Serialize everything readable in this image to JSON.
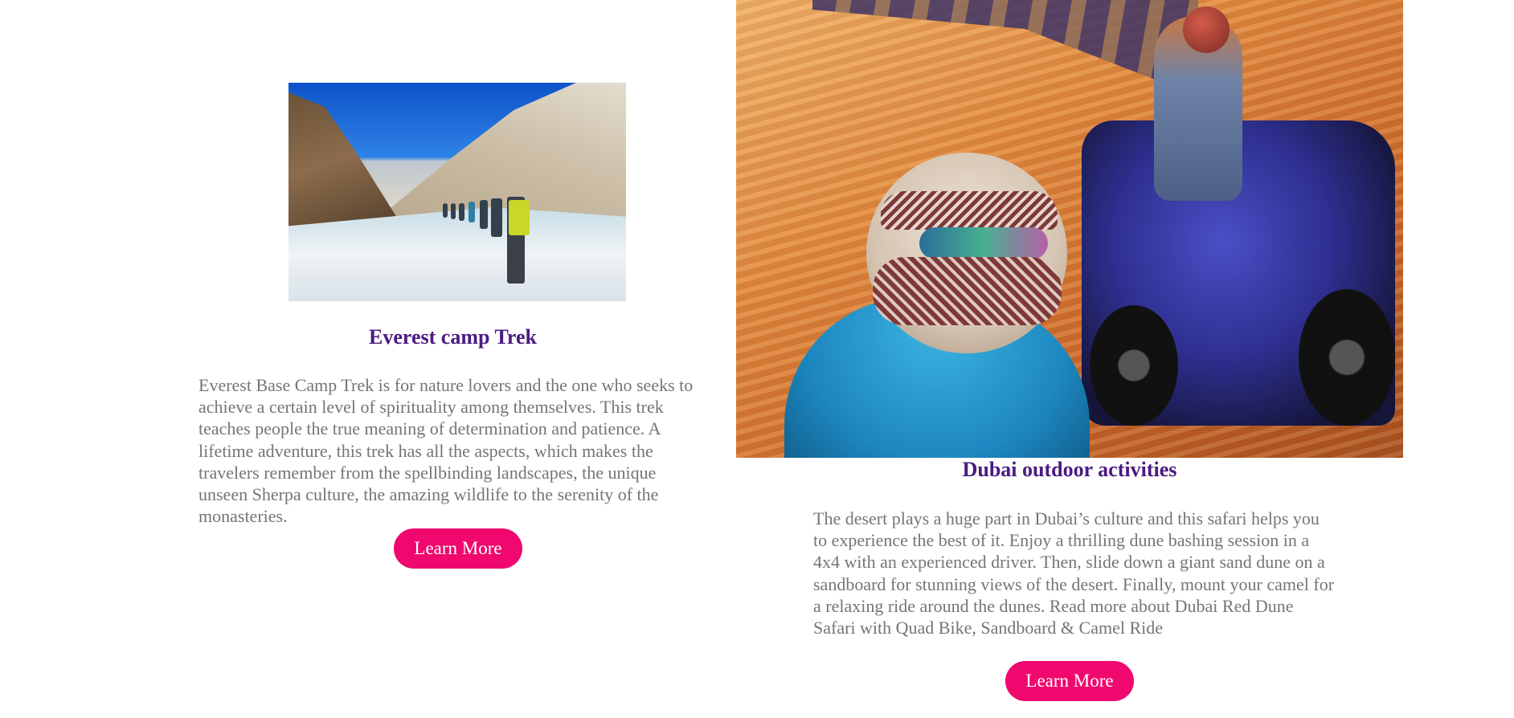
{
  "cards": [
    {
      "title": "Everest camp Trek",
      "description": "Everest Base Camp Trek is for nature lovers and the one who seeks to achieve a certain level of spirituality among themselves. This trek teaches people the true meaning of determination and patience. A lifetime adventure, this trek has all the aspects, which makes the travelers remember from the spellbinding landscapes, the unique unseen Sherpa culture, the amazing wildlife to the serenity of the monasteries.",
      "button_label": "Learn More",
      "image": "trekkers-on-frozen-river-photo"
    },
    {
      "title": "Dubai outdoor activities",
      "description": "The desert plays a huge part in Dubai’s culture and this safari helps you to experience the best of it. Enjoy a thrilling dune bashing session in a 4x4 with an experienced driver. Then, slide down a giant sand dune on a sandboard for stunning views of the desert. Finally, mount your camel for a relaxing ride around the dunes. Read more about Dubai Red Dune Safari with Quad Bike, Sandboard & Camel Ride",
      "button_label": "Learn More",
      "image": "desert-quad-bike-selfie-photo"
    }
  ],
  "colors": {
    "title": "#4a1a82",
    "text": "#757575",
    "button": "#f0086e",
    "button_text": "#ffffff"
  }
}
